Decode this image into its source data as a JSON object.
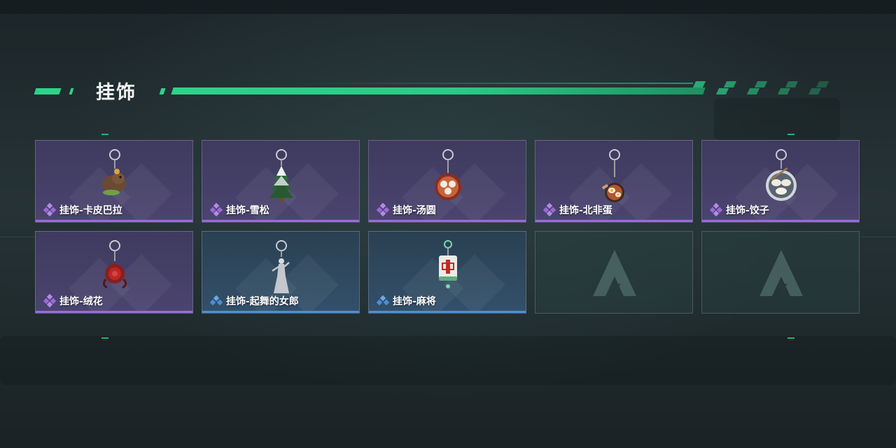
{
  "section": {
    "title": "挂饰"
  },
  "colors": {
    "accent": "#2ed28a",
    "rarity_purple": "#9a6ad8",
    "rarity_blue": "#4b8fd6"
  },
  "items": [
    {
      "label": "挂饰-卡皮巴拉",
      "rarity": "purple",
      "icon": "capybara-charm-icon"
    },
    {
      "label": "挂饰-雪松",
      "rarity": "purple",
      "icon": "snow-pine-charm-icon"
    },
    {
      "label": "挂饰-汤圆",
      "rarity": "purple",
      "icon": "tangyuan-charm-icon"
    },
    {
      "label": "挂饰-北非蛋",
      "rarity": "purple",
      "icon": "shakshuka-charm-icon"
    },
    {
      "label": "挂饰-饺子",
      "rarity": "purple",
      "icon": "dumpling-charm-icon"
    },
    {
      "label": "挂饰-绒花",
      "rarity": "purple",
      "icon": "velvet-flower-charm-icon"
    },
    {
      "label": "挂饰-起舞的女郎",
      "rarity": "blue",
      "icon": "dancing-lady-charm-icon"
    },
    {
      "label": "挂饰-麻将",
      "rarity": "blue",
      "icon": "mahjong-charm-icon"
    }
  ],
  "empty_slots": [
    {
      "icon": "placeholder-logo-icon"
    },
    {
      "icon": "placeholder-logo-icon"
    }
  ]
}
